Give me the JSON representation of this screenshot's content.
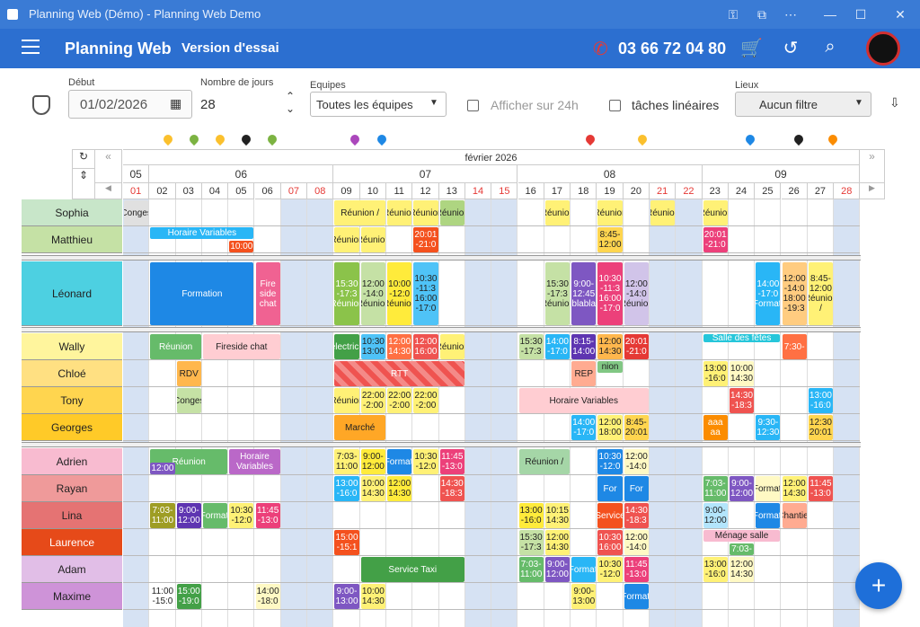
{
  "window": {
    "title": "Planning Web (Démo) - Planning Web Demo"
  },
  "appbar": {
    "brand": "Planning Web",
    "trial": "Version d'essai",
    "phone": "03 66 72 04 80"
  },
  "toolbar": {
    "start_label": "Début",
    "start_value": "01/02/2026",
    "days_label": "Nombre de jours",
    "days_value": "28",
    "teams_label": "Equipes",
    "teams_value": "Toutes les équipes",
    "show24_label": "Afficher sur 24h",
    "linear_label": "tâches linéaires",
    "places_label": "Lieux",
    "places_value": "Aucun filtre"
  },
  "calendar": {
    "month": "février 2026",
    "weeks": [
      {
        "num": "05"
      },
      {
        "num": "06"
      },
      {
        "num": "07"
      },
      {
        "num": "08"
      },
      {
        "num": "09"
      }
    ],
    "days": [
      "01",
      "02",
      "03",
      "04",
      "05",
      "06",
      "07",
      "08",
      "09",
      "10",
      "11",
      "12",
      "13",
      "14",
      "15",
      "16",
      "17",
      "18",
      "19",
      "20",
      "21",
      "22",
      "23",
      "24",
      "25",
      "26",
      "27",
      "28"
    ]
  },
  "people": [
    "Sophia",
    "Matthieu",
    "Léonard",
    "Wally",
    "Chloé",
    "Tony",
    "Georges",
    "Adrien",
    "Rayan",
    "Lina",
    "Laurence",
    "Adam",
    "Maxime"
  ],
  "person_colors": [
    "#c8e6c9",
    "#c5e1a5",
    "#4dd0e1",
    "#fff59d",
    "#ffe082",
    "#ffd54f",
    "#ffca28",
    "#f8bbd0",
    "#ef9a9a",
    "#e57373",
    "#e64a19",
    "#e1bee7",
    "#ce93d8"
  ],
  "events": [
    {
      "t": "Conges"
    },
    {
      "t": "Réunion /"
    },
    {
      "t": "Réunion"
    },
    {
      "t": "Réunion"
    },
    {
      "t": "Réunion"
    },
    {
      "t": "Réunion"
    },
    {
      "t": "Réunion"
    },
    {
      "t": "Réunion"
    },
    {
      "t": "Réunion"
    },
    {
      "t": "Horaire Variables"
    },
    {
      "t": "10:00"
    },
    {
      "t": "Réunion"
    },
    {
      "t": "Réunion"
    },
    {
      "t": "20:01 -21:0"
    },
    {
      "t": "8:45- 12:00"
    },
    {
      "t": "20:01 -21:0"
    },
    {
      "t": "Formation"
    },
    {
      "t": "Fire side chat"
    },
    {
      "t": "15:30 -17:3 Réunion"
    },
    {
      "t": "12:00 -14:0 Réunion"
    },
    {
      "t": "10:00 -12:0 Réunion"
    },
    {
      "t": "10:30 -11:3 16:00 -17:0"
    },
    {
      "t": "15:30 -17:3 Réunion"
    },
    {
      "t": "9:00- 12:45 blabla"
    },
    {
      "t": "10:30 -11:3 16:00 -17:0"
    },
    {
      "t": "12:00 -14:0 Réunion"
    },
    {
      "t": "14:00 -17:0 Formati"
    },
    {
      "t": "12:00 -14:0 18:00 -19:3"
    },
    {
      "t": "8:45- 12:00 Réunion /"
    },
    {
      "t": "Réunion"
    },
    {
      "t": "Fireside chat"
    },
    {
      "t": "electricit"
    },
    {
      "t": "10:30 13:00"
    },
    {
      "t": "12:00 14:30"
    },
    {
      "t": "12:00 16:00"
    },
    {
      "t": "Réunion"
    },
    {
      "t": "15:30 -17:3"
    },
    {
      "t": "14:00 -17:0"
    },
    {
      "t": "8:15- 14:00"
    },
    {
      "t": "12:00 14:30"
    },
    {
      "t": "20:01 -21:0"
    },
    {
      "t": "Salle des fêtes"
    },
    {
      "t": "7:30-"
    },
    {
      "t": "RDV"
    },
    {
      "t": "RTT"
    },
    {
      "t": "REP"
    },
    {
      "t": "nion"
    },
    {
      "t": "13:00 -16:0"
    },
    {
      "t": "10:00 14:30"
    },
    {
      "t": "Réunion"
    },
    {
      "t": "22:00 -2:00"
    },
    {
      "t": "22:00 -2:00"
    },
    {
      "t": "22:00 -2:00"
    },
    {
      "t": "Conges"
    },
    {
      "t": "Horaire Variables"
    },
    {
      "t": "14:30 -18:3"
    },
    {
      "t": "13:00 -16:0"
    },
    {
      "t": "Marché"
    },
    {
      "t": "14:00 -17:0"
    },
    {
      "t": "12:00 18:00"
    },
    {
      "t": "8:45- 20:01"
    },
    {
      "t": "aaa aa"
    },
    {
      "t": "9:30- 12:30"
    },
    {
      "t": "12:30 20:01"
    },
    {
      "t": "Réunion"
    },
    {
      "t": "12:00"
    },
    {
      "t": "Horaire Variables"
    },
    {
      "t": "7:03- 11:00"
    },
    {
      "t": "9:00- 12:00"
    },
    {
      "t": "Formati"
    },
    {
      "t": "10:30 -12:0"
    },
    {
      "t": "11:45 -13:0"
    },
    {
      "t": "Réunion /"
    },
    {
      "t": "10:30 -12:0"
    },
    {
      "t": "12:00 -14:0"
    },
    {
      "t": "13:00 -16:0"
    },
    {
      "t": "10:00 14:30"
    },
    {
      "t": "12:00 14:30"
    },
    {
      "t": "14:30 -18:3"
    },
    {
      "t": "For"
    },
    {
      "t": "For"
    },
    {
      "t": "7:03- 11:00"
    },
    {
      "t": "9:00- 12:00"
    },
    {
      "t": "Formati"
    },
    {
      "t": "12:00 14:30"
    },
    {
      "t": "11:45 -13:0"
    },
    {
      "t": "7:03- 11:00"
    },
    {
      "t": "9:00- 12:00"
    },
    {
      "t": "Formati"
    },
    {
      "t": "10:30 -12:0"
    },
    {
      "t": "11:45 -13:0"
    },
    {
      "t": "13:00 -16:0"
    },
    {
      "t": "10:15 14:30"
    },
    {
      "t": "Service"
    },
    {
      "t": "14:30 -18:3"
    },
    {
      "t": "9:00- 12:00"
    },
    {
      "t": "Formati"
    },
    {
      "t": "Chantier"
    },
    {
      "t": "15:00 -15:1"
    },
    {
      "t": "15:30 -17:3"
    },
    {
      "t": "12:00 14:30"
    },
    {
      "t": "10:30 16:00"
    },
    {
      "t": "12:00 -14:0"
    },
    {
      "t": "Ménage salle"
    },
    {
      "t": "7:03-"
    },
    {
      "t": "Service Taxi"
    },
    {
      "t": "7:03- 11:00"
    },
    {
      "t": "9:00- 12:00"
    },
    {
      "t": "Formati"
    },
    {
      "t": "10:30 -12:0"
    },
    {
      "t": "11:45 -13:0"
    },
    {
      "t": "13:00 -16:0"
    },
    {
      "t": "12:00 14:30"
    },
    {
      "t": "11:00 -15:0"
    },
    {
      "t": "15:00 -19:0"
    },
    {
      "t": "14:00 -18:0"
    },
    {
      "t": "9:00- 13:00"
    },
    {
      "t": "10:00 14:30"
    },
    {
      "t": "12:00 -14:0"
    },
    {
      "t": "9:00- 13:00"
    },
    {
      "t": "Formati"
    }
  ]
}
